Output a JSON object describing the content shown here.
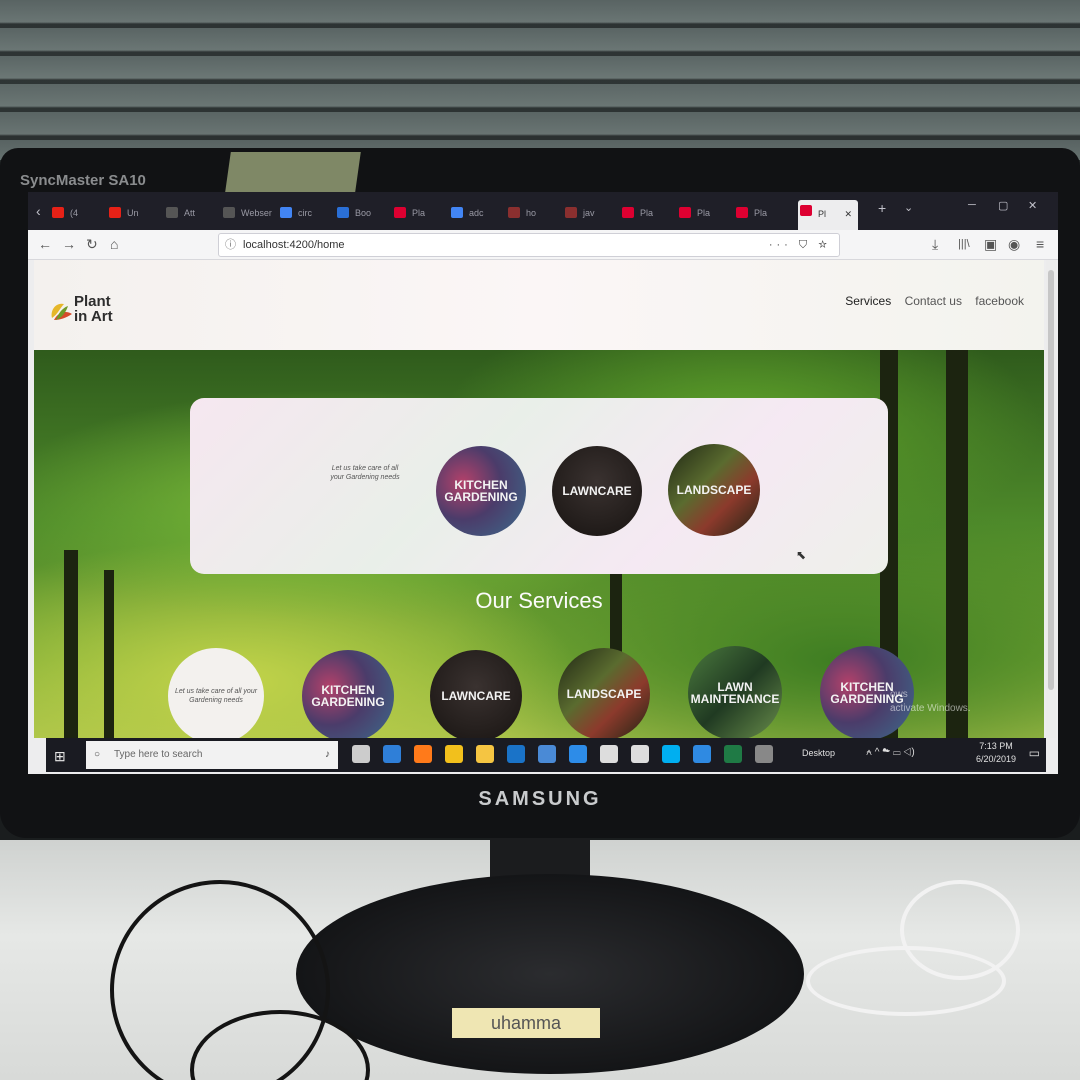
{
  "monitor": {
    "model_label": "SyncMaster SA10",
    "brand_label": "SAMSUNG",
    "sticker_text": "uhamma"
  },
  "browser": {
    "tabs": [
      {
        "label": "(4",
        "icon": "youtube-icon",
        "color": "#e62117"
      },
      {
        "label": "Un",
        "icon": "youtube-icon",
        "color": "#e62117"
      },
      {
        "label": "Att",
        "icon": "page-icon",
        "color": "#555555"
      },
      {
        "label": "Webser",
        "icon": "page-icon",
        "color": "#555555"
      },
      {
        "label": "circ",
        "icon": "google-icon",
        "color": "#4285f4"
      },
      {
        "label": "Boo",
        "icon": "site-icon",
        "color": "#2a6fd6"
      },
      {
        "label": "Pla",
        "icon": "angular-icon",
        "color": "#dd0031"
      },
      {
        "label": "adc",
        "icon": "google-icon",
        "color": "#4285f4"
      },
      {
        "label": "ho",
        "icon": "site-icon",
        "color": "#8a2f2f"
      },
      {
        "label": "jav",
        "icon": "site-icon",
        "color": "#8a2f2f"
      },
      {
        "label": "Pla",
        "icon": "angular-icon",
        "color": "#dd0031"
      },
      {
        "label": "Pla",
        "icon": "angular-icon",
        "color": "#dd0031"
      },
      {
        "label": "Pla",
        "icon": "angular-icon",
        "color": "#dd0031"
      }
    ],
    "active_tab": {
      "label": "Pl",
      "icon": "angular-icon",
      "color": "#dd0031"
    },
    "url": "localhost:4200/home"
  },
  "site": {
    "logo_line1": "Plant",
    "logo_line2": "in Art",
    "nav": [
      "Services",
      "Contact us",
      "facebook"
    ],
    "card_tagline": "Let us take care of all your Gardening needs",
    "card_circles": [
      {
        "label": "KITCHEN GARDENING",
        "style": "kitchen"
      },
      {
        "label": "LAWNCARE",
        "style": "lawn"
      },
      {
        "label": "LANDSCAPE",
        "style": "landscape"
      }
    ],
    "section_title": "Our Services",
    "service_circles": [
      {
        "label": "Let us take care of all your Gardening needs",
        "style": "white"
      },
      {
        "label": "KITCHEN GARDENING",
        "style": "kitchen"
      },
      {
        "label": "LAWNCARE",
        "style": "lawn"
      },
      {
        "label": "LANDSCAPE",
        "style": "landscape"
      },
      {
        "label": "LAWN MAINTENANCE",
        "style": "maint"
      },
      {
        "label": "KITCHEN GARDENING",
        "style": "kitchen"
      }
    ],
    "watermark_line1": "ows",
    "watermark_line2": "activate Windows."
  },
  "taskbar": {
    "search_placeholder": "Type here to search",
    "desktop_label": "Desktop",
    "time": "7:13 PM",
    "date": "6/20/2019",
    "app_icons": [
      {
        "name": "task-view-icon",
        "color": "#cccccc"
      },
      {
        "name": "edge-icon",
        "color": "#2f7fd8"
      },
      {
        "name": "firefox-icon",
        "color": "#ff7a1a"
      },
      {
        "name": "chrome-icon",
        "color": "#f2c01c"
      },
      {
        "name": "file-explorer-icon",
        "color": "#f5c542"
      },
      {
        "name": "outlook-icon",
        "color": "#1a73c8"
      },
      {
        "name": "store-icon",
        "color": "#4a8ad6"
      },
      {
        "name": "photoshop-icon",
        "color": "#2d8ce8"
      },
      {
        "name": "unity-icon",
        "color": "#dddddd"
      },
      {
        "name": "unity-hub-icon",
        "color": "#dddddd"
      },
      {
        "name": "skype-icon",
        "color": "#00aff0"
      },
      {
        "name": "vscode-icon",
        "color": "#2f8ae2"
      },
      {
        "name": "excel-icon",
        "color": "#1f7a45"
      },
      {
        "name": "terminal-icon",
        "color": "#888888"
      }
    ]
  }
}
